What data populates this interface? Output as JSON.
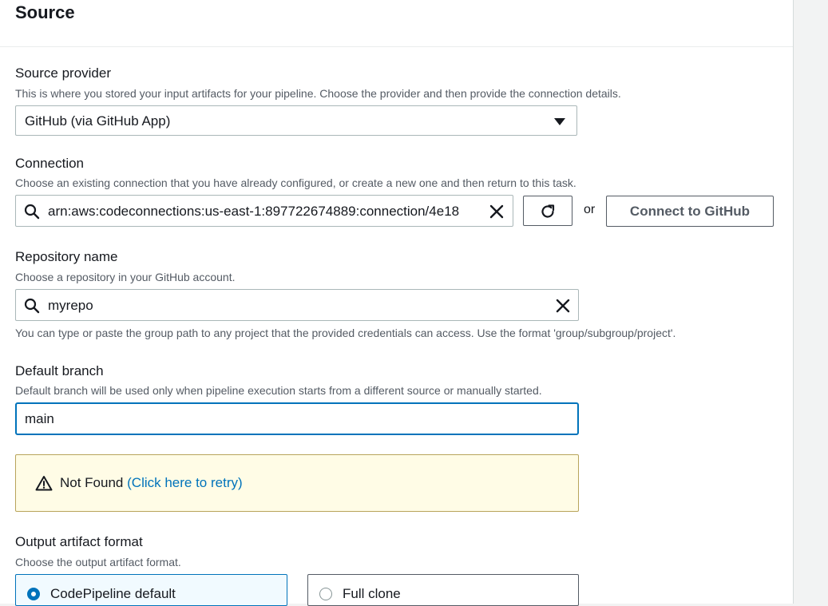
{
  "section": {
    "title": "Source"
  },
  "source_provider": {
    "label": "Source provider",
    "description": "This is where you stored your input artifacts for your pipeline. Choose the provider and then provide the connection details.",
    "selected": "GitHub (via GitHub App)"
  },
  "connection": {
    "label": "Connection",
    "description": "Choose an existing connection that you have already configured, or create a new one and then return to this task.",
    "value": "arn:aws:codeconnections:us-east-1:897722674889:connection/4e18",
    "or_text": "or",
    "connect_button": "Connect to GitHub"
  },
  "repository": {
    "label": "Repository name",
    "description": "Choose a repository in your GitHub account.",
    "value": "myrepo",
    "hint": "You can type or paste the group path to any project that the provided credentials can access. Use the format 'group/subgroup/project'."
  },
  "default_branch": {
    "label": "Default branch",
    "description": "Default branch will be used only when pipeline execution starts from a different source or manually started.",
    "value": "main"
  },
  "alert": {
    "message": "Not Found",
    "retry_link": "(Click here to retry)",
    "color": "#fffce6"
  },
  "output_artifact": {
    "label": "Output artifact format",
    "description": "Choose the output artifact format.",
    "options": [
      {
        "label": "CodePipeline default",
        "selected": true
      },
      {
        "label": "Full clone",
        "selected": false
      }
    ]
  },
  "colors": {
    "accent": "#0073bb",
    "text": "#16191f",
    "secondary": "#545b64"
  }
}
